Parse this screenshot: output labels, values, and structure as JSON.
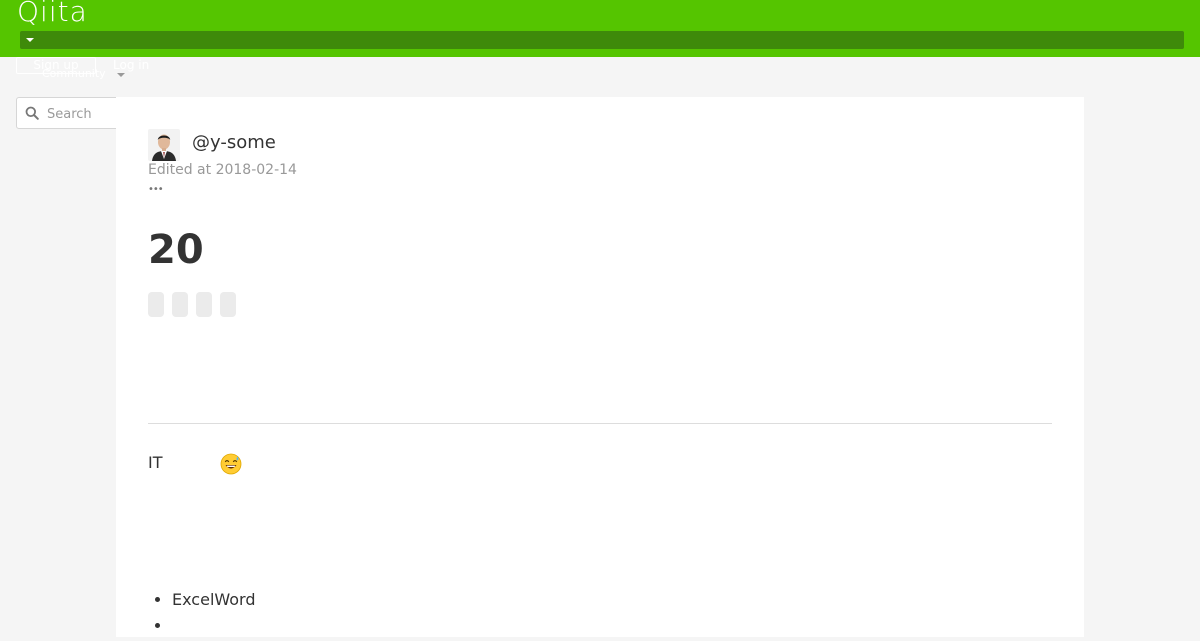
{
  "header": {
    "logo_text": "Qiita",
    "brand_color": "#55c500",
    "signup_label": "Sign up",
    "login_label": "Log in",
    "community_label": "Community"
  },
  "search": {
    "placeholder": "Search",
    "value": ""
  },
  "article": {
    "author": "@y-some",
    "edited": "Edited at 2018-02-14",
    "more_glyph": "•••",
    "title": "20",
    "tag_count": 4,
    "paragraph_text": "IT",
    "emoji": "sweat-smile-emoji",
    "list_items": [
      "ExcelWord",
      ""
    ]
  }
}
